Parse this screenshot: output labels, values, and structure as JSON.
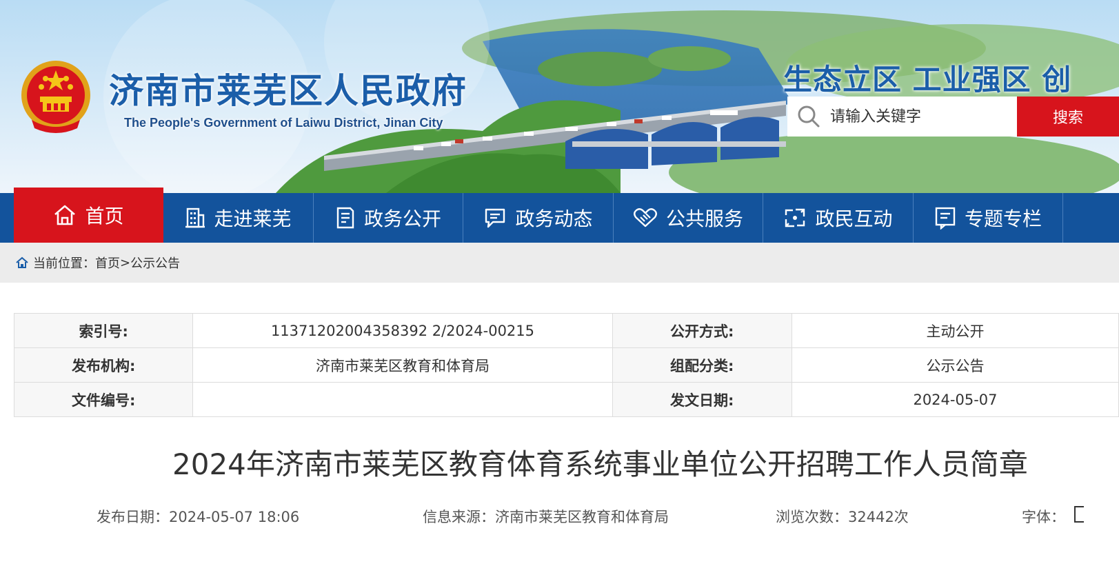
{
  "header": {
    "site_title": "济南市莱芜区人民政府",
    "site_subtitle": "The People's Government of Laiwu District, Jinan City",
    "slogan": "生态立区  工业强区  创",
    "search": {
      "placeholder": "请输入关键字",
      "button_label": "搜索"
    }
  },
  "nav": {
    "items": [
      {
        "label": "首页",
        "icon": "home-icon",
        "active": true
      },
      {
        "label": "走进莱芜",
        "icon": "building-icon"
      },
      {
        "label": "政务公开",
        "icon": "document-icon"
      },
      {
        "label": "政务动态",
        "icon": "chat-icon"
      },
      {
        "label": "公共服务",
        "icon": "handshake-icon"
      },
      {
        "label": "政民互动",
        "icon": "exchange-icon"
      },
      {
        "label": "专题专栏",
        "icon": "board-icon"
      }
    ]
  },
  "breadcrumb": {
    "prefix": "当前位置：",
    "home": "首页",
    "separator": ">",
    "current": "公示公告"
  },
  "info": {
    "index_label": "索引号:",
    "index_value": "11371202004358392 2/2024-00215",
    "disclosure_label": "公开方式:",
    "disclosure_value": "主动公开",
    "publisher_label": "发布机构:",
    "publisher_value": "济南市莱芜区教育和体育局",
    "category_label": "组配分类:",
    "category_value": "公示公告",
    "docno_label": "文件编号:",
    "docno_value": "",
    "date_label": "发文日期:",
    "date_value": "2024-05-07"
  },
  "article": {
    "title": "2024年济南市莱芜区教育体育系统事业单位公开招聘工作人员简章",
    "publish_date": "发布日期：2024-05-07 18:06",
    "source": "信息来源：济南市莱芜区教育和体育局",
    "views": "浏览次数：32442次",
    "font_label": "字体："
  },
  "colors": {
    "brand_blue": "#13539c",
    "accent_red": "#d7141c"
  }
}
